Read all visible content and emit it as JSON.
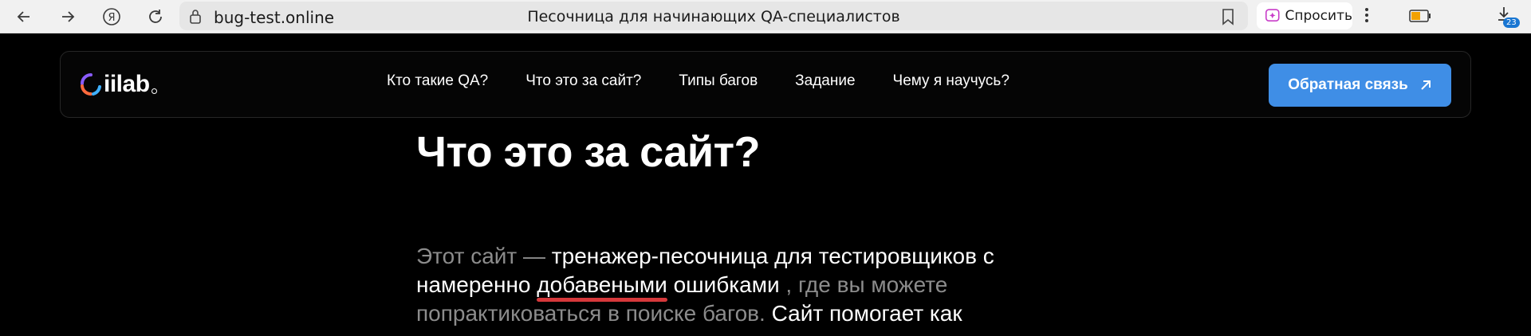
{
  "browser": {
    "url": "bug-test.online",
    "tab_title": "Песочница для начинающих QA-специалистов",
    "ask_label": "Спросить",
    "downloads_count": "23"
  },
  "header": {
    "logo_text": "iilab",
    "nav": [
      "Кто такие QA?",
      "Что это за сайт?",
      "Типы багов",
      "Задание",
      "Чему я научусь?"
    ],
    "feedback_label": "Обратная связь"
  },
  "main": {
    "heading": "Что это за сайт?",
    "para": {
      "p1": "Этот сайт —",
      "p2": "тренажер-песочница для тестировщиков с намеренно",
      "p3": "добавеными",
      "p4": "ошибками",
      "p5": ", где вы можете попрактиковаться в поиске багов.",
      "p6": "Сайт помогает как"
    }
  },
  "colors": {
    "accent_blue": "#3f8ee6",
    "underline_red": "#d6383b",
    "background": "#000000"
  }
}
